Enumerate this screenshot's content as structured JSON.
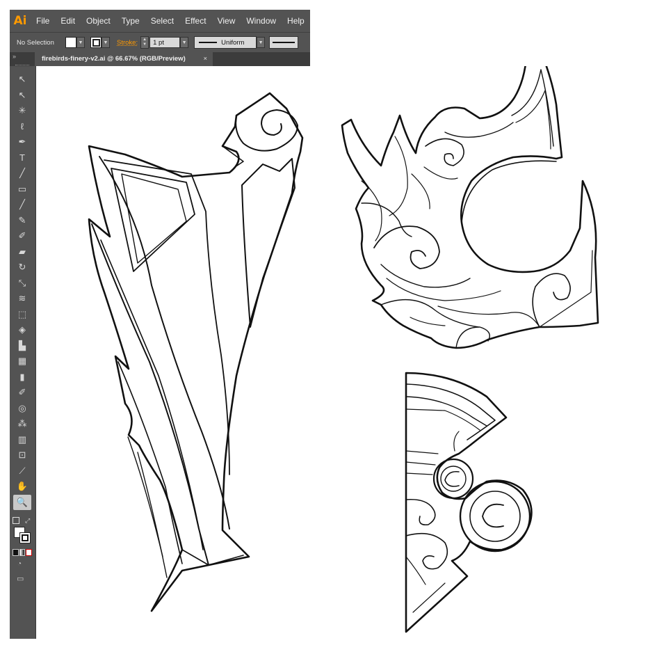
{
  "app": {
    "logo": "Ai"
  },
  "menu": [
    "File",
    "Edit",
    "Object",
    "Type",
    "Select",
    "Effect",
    "View",
    "Window",
    "Help"
  ],
  "control": {
    "selection": "No Selection",
    "stroke_label": "Stroke:",
    "stroke_weight": "1 pt",
    "profile": "Uniform"
  },
  "document": {
    "tab": "firebirds-finery-v2.ai @ 66.67% (RGB/Preview)",
    "close": "×"
  },
  "tools": [
    {
      "name": "selection-tool-icon",
      "glyph": "↖",
      "active": false
    },
    {
      "name": "direct-selection-tool-icon",
      "glyph": "↖",
      "active": false
    },
    {
      "name": "magic-wand-tool-icon",
      "glyph": "✳",
      "active": false
    },
    {
      "name": "lasso-tool-icon",
      "glyph": "ℓ",
      "active": false
    },
    {
      "name": "pen-tool-icon",
      "glyph": "✒",
      "active": false
    },
    {
      "name": "type-tool-icon",
      "glyph": "T",
      "active": false
    },
    {
      "name": "line-tool-icon",
      "glyph": "╱",
      "active": false
    },
    {
      "name": "rectangle-tool-icon",
      "glyph": "▭",
      "active": false
    },
    {
      "name": "paintbrush-tool-icon",
      "glyph": "╱",
      "active": false
    },
    {
      "name": "pencil-tool-icon",
      "glyph": "✎",
      "active": false
    },
    {
      "name": "blob-brush-tool-icon",
      "glyph": "✐",
      "active": false
    },
    {
      "name": "eraser-tool-icon",
      "glyph": "▰",
      "active": false
    },
    {
      "name": "rotate-tool-icon",
      "glyph": "↻",
      "active": false
    },
    {
      "name": "scale-tool-icon",
      "glyph": "⤡",
      "active": false
    },
    {
      "name": "width-tool-icon",
      "glyph": "≋",
      "active": false
    },
    {
      "name": "free-transform-tool-icon",
      "glyph": "⬚",
      "active": false
    },
    {
      "name": "shape-builder-tool-icon",
      "glyph": "◈",
      "active": false
    },
    {
      "name": "graph-tool-icon",
      "glyph": "▙",
      "active": false
    },
    {
      "name": "mesh-tool-icon",
      "glyph": "▦",
      "active": false
    },
    {
      "name": "gradient-tool-icon",
      "glyph": "▮",
      "active": false
    },
    {
      "name": "eyedropper-tool-icon",
      "glyph": "✐",
      "active": false
    },
    {
      "name": "blend-tool-icon",
      "glyph": "◎",
      "active": false
    },
    {
      "name": "symbol-sprayer-tool-icon",
      "glyph": "⁂",
      "active": false
    },
    {
      "name": "column-graph-tool-icon",
      "glyph": "▥",
      "active": false
    },
    {
      "name": "artboard-tool-icon",
      "glyph": "⊡",
      "active": false
    },
    {
      "name": "slice-tool-icon",
      "glyph": "⟋",
      "active": false
    },
    {
      "name": "hand-tool-icon",
      "glyph": "✋",
      "active": false
    },
    {
      "name": "zoom-tool-icon",
      "glyph": "🔍",
      "active": true
    }
  ],
  "colors": {
    "ui_dark": "#535353",
    "accent": "#ff9a00",
    "artboard": "#ffffff",
    "ink": "#111111"
  }
}
